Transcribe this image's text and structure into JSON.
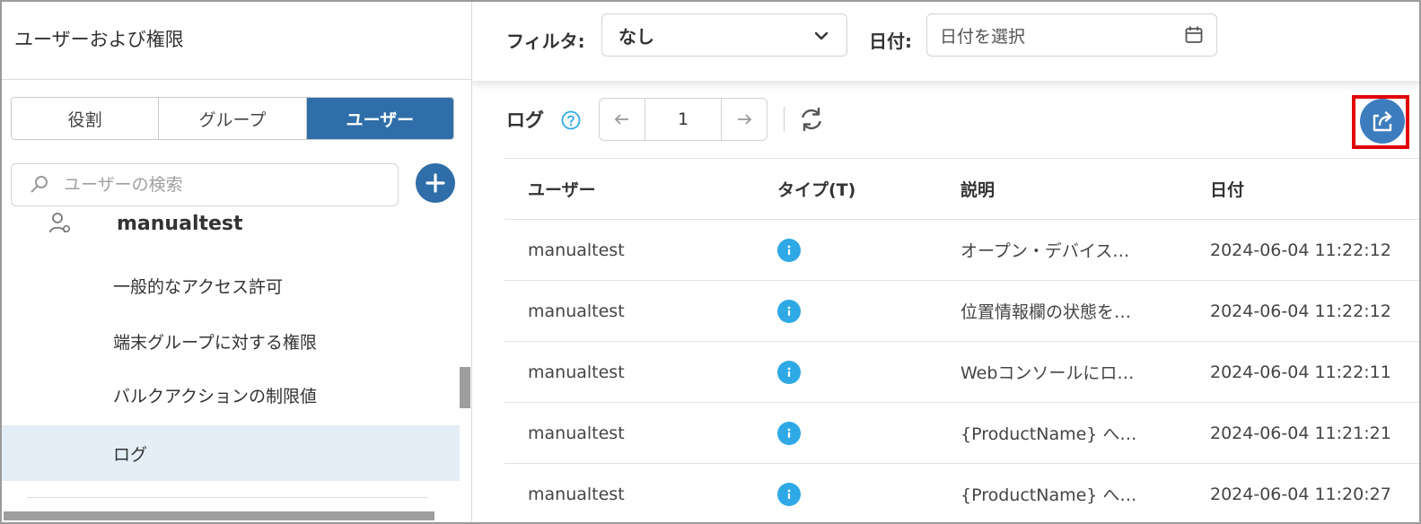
{
  "sidebar": {
    "title": "ユーザーおよび権限",
    "tabs": [
      {
        "label": "役割"
      },
      {
        "label": "グループ"
      },
      {
        "label": "ユーザー"
      }
    ],
    "search_placeholder": "ユーザーの検索",
    "user_name": "manualtest",
    "menu": [
      {
        "label": "一般的なアクセス許可"
      },
      {
        "label": "端末グループに対する権限"
      },
      {
        "label": "バルクアクションの制限値"
      },
      {
        "label": "ログ"
      }
    ],
    "active_tab": "ユーザー",
    "active_menu": "ログ"
  },
  "filter": {
    "filter_label": "フィルタ:",
    "filter_value": "なし",
    "date_label": "日付:",
    "date_placeholder": "日付を選択"
  },
  "log": {
    "title": "ログ",
    "page": "1",
    "columns": [
      "ユーザー",
      "タイプ(T)",
      "説明",
      "日付"
    ],
    "rows": [
      {
        "user": "manualtest",
        "type": "info",
        "description": "オープン・デバイス…",
        "date": "2024-06-04 11:22:12"
      },
      {
        "user": "manualtest",
        "type": "info",
        "description": "位置情報欄の状態を…",
        "date": "2024-06-04 11:22:12"
      },
      {
        "user": "manualtest",
        "type": "info",
        "description": "Webコンソールにロ…",
        "date": "2024-06-04 11:22:11"
      },
      {
        "user": "manualtest",
        "type": "info",
        "description": "{ProductName} へ…",
        "date": "2024-06-04 11:21:21"
      },
      {
        "user": "manualtest",
        "type": "info",
        "description": "{ProductName} へ…",
        "date": "2024-06-04 11:20:27"
      }
    ]
  },
  "colors": {
    "accent": "#2f6ea8",
    "export_button": "#3d7dbe",
    "info_icon": "#2fa9e6",
    "highlight_frame": "#e00000",
    "active_menu_bg": "#e3eef7"
  },
  "icons": [
    "search-icon",
    "plus-icon",
    "user-icon",
    "chevron-down-icon",
    "calendar-icon",
    "help-icon",
    "arrow-left-icon",
    "arrow-right-icon",
    "refresh-icon",
    "export-icon",
    "info-icon"
  ]
}
